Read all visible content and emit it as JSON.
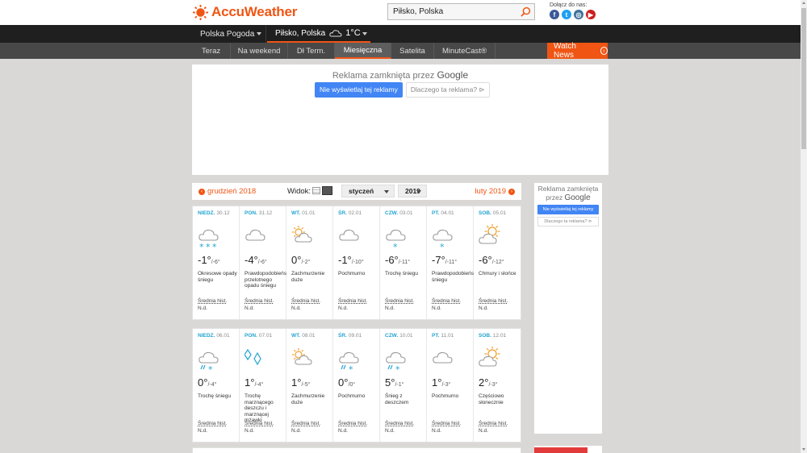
{
  "brand": {
    "name": "AccuWeather",
    "accent": "#f05514"
  },
  "search": {
    "value": "Piłsko, Polska"
  },
  "social": {
    "label": "Dołącz do nas:",
    "icons": [
      "facebook-icon",
      "twitter-icon",
      "instagram-icon",
      "youtube-icon"
    ]
  },
  "nav": {
    "region": "Polska Pogoda",
    "location": "Piłsko, Polska",
    "current_temp": "1°C"
  },
  "tabs": [
    "Teraz",
    "Na weekend",
    "Dł Term.",
    "Miesięczna",
    "Satelita",
    "MinuteCast®"
  ],
  "active_tab": "Miesięczna",
  "watch_news": "Watch News",
  "ad": {
    "closed_text": "Reklama zamknięta przez",
    "google": "Google",
    "stop_button": "Nie wyświetlaj tej reklamy",
    "why_button": "Dlaczego ta reklama?",
    "side_closed_text_1": "Reklama zamknięta",
    "side_closed_text_2": "przez",
    "side_stop_button": "Nie wyświetlaj tej reklamy",
    "side_why_button": "Dlaczego ta reklama?"
  },
  "month_nav": {
    "prev": "grudzień 2018",
    "view_label": "Widok:",
    "month_select": "styczeń",
    "year_select": "2019",
    "next": "luty 2019"
  },
  "weeks": [
    [
      {
        "dow": "NIEDZ.",
        "date": "30.12",
        "hi": "-1°",
        "lo": "/-6°",
        "desc": "Okresowe opady śniegu",
        "hist": "Średnia hist.",
        "hist_val": "N.d.",
        "icon": "cloud-snow-heavy"
      },
      {
        "dow": "PON.",
        "date": "31.12",
        "hi": "-4°",
        "lo": "/-6°",
        "desc": "Prawdopodobieńs przelotnego opadu śniegu",
        "hist": "Średnia hist.",
        "hist_val": "N.d.",
        "icon": "cloud"
      },
      {
        "dow": "WT.",
        "date": "01.01",
        "hi": "0°",
        "lo": "/-2°",
        "desc": "Zachmurzenie duże",
        "hist": "Średnia hist.",
        "hist_val": "N.d.",
        "icon": "sun-cloud"
      },
      {
        "dow": "ŚR.",
        "date": "02.01",
        "hi": "-1°",
        "lo": "/-10°",
        "desc": "Pochmurno",
        "hist": "Średnia hist.",
        "hist_val": "N.d.",
        "icon": "cloud"
      },
      {
        "dow": "CZW.",
        "date": "03.01",
        "hi": "-6°",
        "lo": "/-11°",
        "desc": "Trochę śniegu",
        "hist": "Średnia hist.",
        "hist_val": "N.d.",
        "icon": "cloud-snow"
      },
      {
        "dow": "PT.",
        "date": "04.01",
        "hi": "-7°",
        "lo": "/-11°",
        "desc": "Prawdopodobieńs śniegu",
        "hist": "Średnia hist.",
        "hist_val": "N.d.",
        "icon": "cloud-snow"
      },
      {
        "dow": "SOB.",
        "date": "05.01",
        "hi": "-6°",
        "lo": "/-12°",
        "desc": "Chmury i słońce",
        "hist": "Średnia hist.",
        "hist_val": "N.d.",
        "icon": "sun-cloud-orange"
      }
    ],
    [
      {
        "dow": "NIEDZ.",
        "date": "06.01",
        "hi": "0°",
        "lo": "/-4°",
        "desc": "Trochę śniegu",
        "hist": "Średnia hist.",
        "hist_val": "N.d.",
        "icon": "cloud-sleet"
      },
      {
        "dow": "PON.",
        "date": "07.01",
        "hi": "1°",
        "lo": "/-4°",
        "desc": "Trochę marznącego deszczu i marznącej mżawki",
        "hist": "Średnia hist.",
        "hist_val": "N.d.",
        "icon": "ice"
      },
      {
        "dow": "WT.",
        "date": "08.01",
        "hi": "1°",
        "lo": "/-5°",
        "desc": "Zachmurzenie duże",
        "hist": "Średnia hist.",
        "hist_val": "N.d.",
        "icon": "sun-cloud"
      },
      {
        "dow": "ŚR.",
        "date": "09.01",
        "hi": "0°",
        "lo": "/0°",
        "desc": "Pochmurno",
        "hist": "Średnia hist.",
        "hist_val": "N.d.",
        "icon": "cloud-sleet"
      },
      {
        "dow": "CZW.",
        "date": "10.01",
        "hi": "5°",
        "lo": "/-1°",
        "desc": "Śnieg z deszczem",
        "hist": "Średnia hist.",
        "hist_val": "N.d.",
        "icon": "cloud-sleet"
      },
      {
        "dow": "PT.",
        "date": "11.01",
        "hi": "1°",
        "lo": "/-3°",
        "desc": "Pochmurno",
        "hist": "Średnia hist.",
        "hist_val": "N.d.",
        "icon": "cloud"
      },
      {
        "dow": "SOB.",
        "date": "12.01",
        "hi": "2°",
        "lo": "/-3°",
        "desc": "Częściowo słonecznie",
        "hist": "Średnia hist.",
        "hist_val": "N.d.",
        "icon": "sun-cloud-orange"
      }
    ]
  ]
}
